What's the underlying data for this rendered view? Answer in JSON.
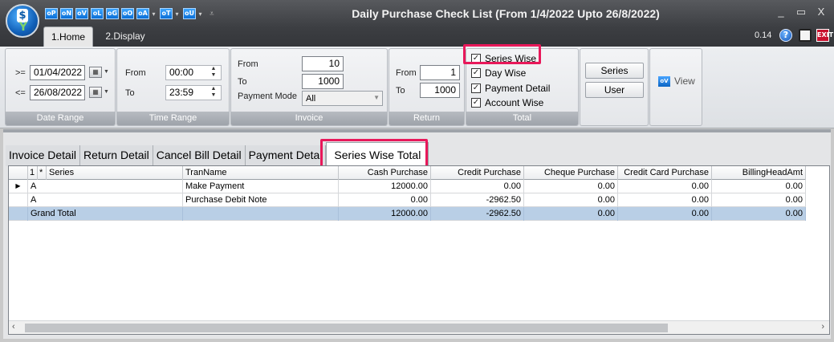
{
  "window": {
    "title": "Daily Purchase Check List (From 1/4/2022 Upto 26/8/2022)",
    "controls": [
      "_",
      "▭",
      "X"
    ]
  },
  "quick_access": [
    {
      "icon": "oP"
    },
    {
      "icon": "oN"
    },
    {
      "icon": "oV"
    },
    {
      "icon": "oL"
    },
    {
      "icon": "oG"
    },
    {
      "icon": "oO"
    },
    {
      "icon": "oA",
      "dropdown": true
    },
    {
      "icon": "oT",
      "dropdown": true
    },
    {
      "icon": "oU",
      "dropdown": true
    }
  ],
  "ribbon_tabs": {
    "home": "1.Home",
    "display": "2.Display"
  },
  "toolbar_right": {
    "zoom": "0.14",
    "help_glyph": "?",
    "exit_glyph": "EXIT"
  },
  "date_range": {
    "caption": "Date Range",
    "from_op": ">=",
    "to_op": "<=",
    "from_date": "01/04/2022",
    "to_date": "26/08/2022"
  },
  "time_range": {
    "caption": "Time Range",
    "from_label": "From",
    "to_label": "To",
    "from_time": "00:00",
    "to_time": "23:59"
  },
  "invoice": {
    "caption": "Invoice",
    "from_label": "From",
    "to_label": "To",
    "from_value": "10",
    "to_value": "1000",
    "payment_mode_label": "Payment Mode",
    "payment_mode_value": "All"
  },
  "return": {
    "caption": "Return",
    "from_label": "From",
    "to_label": "To",
    "from_value": "1",
    "to_value": "1000"
  },
  "total": {
    "caption": "Total",
    "options": [
      {
        "label": "Series Wise",
        "checked": true
      },
      {
        "label": "Day Wise",
        "checked": true
      },
      {
        "label": "Payment Detail",
        "checked": true
      },
      {
        "label": "Account Wise",
        "checked": true
      }
    ],
    "check_glyph": "✓"
  },
  "actions": {
    "series": "Series",
    "user": "User",
    "view": "View",
    "view_icon": "oV"
  },
  "detail_tabs": [
    "Invoice Detail",
    "Return Detail",
    "Cancel Bill Detail",
    "Payment Detai",
    "Series Wise Total"
  ],
  "active_detail_tab": 4,
  "grid": {
    "headers": [
      "1",
      "*",
      "Series",
      "TranName",
      "Cash Purchase",
      "Credit Purchase",
      "Cheque Purchase",
      "Credit Card Purchase",
      "BillingHeadAmt"
    ],
    "rows": [
      {
        "series": "A",
        "tran_name": "Make Payment",
        "cash": "12000.00",
        "credit": "0.00",
        "cheque": "0.00",
        "card": "0.00",
        "billing": "0.00"
      },
      {
        "series": "A",
        "tran_name": "Purchase Debit Note",
        "cash": "0.00",
        "credit": "-2962.50",
        "cheque": "0.00",
        "card": "0.00",
        "billing": "0.00"
      }
    ],
    "total_row": {
      "label": "Grand Total",
      "cash": "12000.00",
      "credit": "-2962.50",
      "cheque": "0.00",
      "card": "0.00",
      "billing": "0.00"
    },
    "current_row_glyph": "▶"
  },
  "colors": {
    "highlight": "#e8185a",
    "total_row": "#b9cfe6",
    "accent": "#1160b8"
  }
}
